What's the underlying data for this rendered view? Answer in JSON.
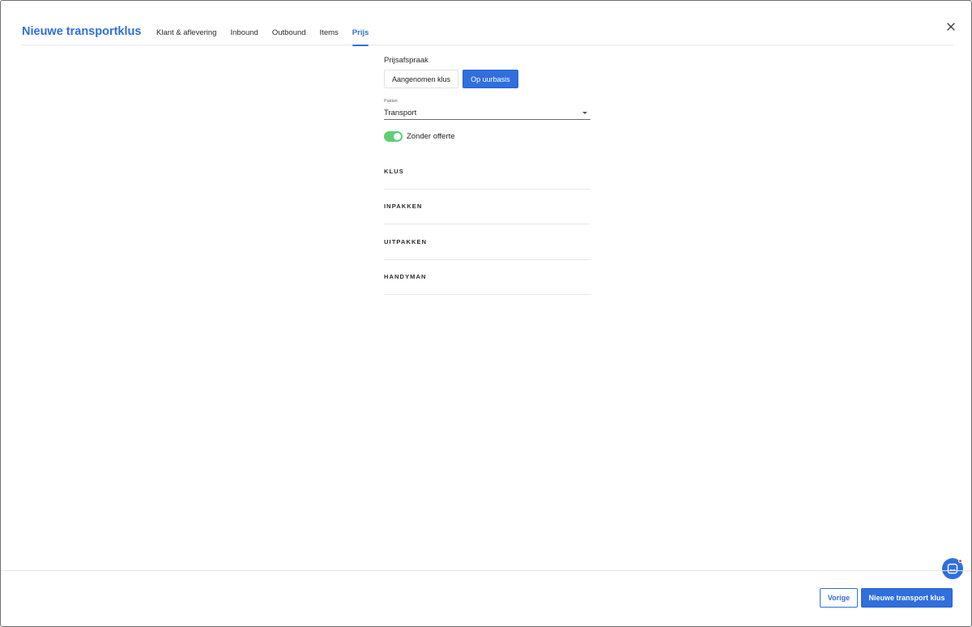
{
  "header": {
    "title": "Nieuwe transportklus",
    "tabs": [
      {
        "label": "Klant & aflevering",
        "active": false
      },
      {
        "label": "Inbound",
        "active": false
      },
      {
        "label": "Outbound",
        "active": false
      },
      {
        "label": "Items",
        "active": false
      },
      {
        "label": "Prijs",
        "active": true
      }
    ],
    "close_icon": "close-icon"
  },
  "form": {
    "price_agreement": {
      "label": "Prijsafspraak",
      "options": [
        {
          "label": "Aangenomen klus",
          "selected": false
        },
        {
          "label": "Op uurbasis",
          "selected": true
        }
      ]
    },
    "package": {
      "caption": "Pakket",
      "value": "Transport"
    },
    "toggle": {
      "label": "Zonder offerte",
      "on": true
    },
    "sections": [
      {
        "title": "KLUS"
      },
      {
        "title": "INPAKKEN"
      },
      {
        "title": "UITPAKKEN"
      },
      {
        "title": "HANDYMAN"
      }
    ]
  },
  "footer": {
    "prev_label": "Vorige",
    "submit_label": "Nieuwe transport klus"
  },
  "colors": {
    "accent": "#2f6fde",
    "toggle_on": "#5fcf76",
    "notification": "#e5484d"
  }
}
